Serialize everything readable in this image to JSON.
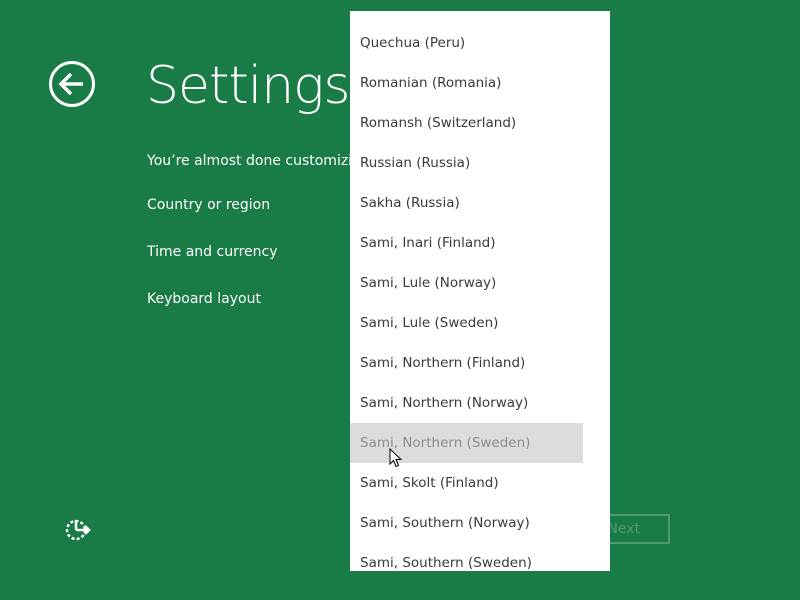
{
  "header": {
    "title": "Settings",
    "back_icon": "back-arrow-icon"
  },
  "main": {
    "intro": "You’re almost done customizing",
    "settings": [
      {
        "label": "Country or region"
      },
      {
        "label": "Time and currency"
      },
      {
        "label": "Keyboard layout"
      }
    ]
  },
  "footer": {
    "next_label": "Next",
    "ease_icon": "ease-of-access-icon"
  },
  "dropdown": {
    "items": [
      {
        "label": "Quechua (Peru)"
      },
      {
        "label": "Romanian (Romania)"
      },
      {
        "label": "Romansh (Switzerland)"
      },
      {
        "label": "Russian (Russia)"
      },
      {
        "label": "Sakha (Russia)"
      },
      {
        "label": "Sami, Inari (Finland)"
      },
      {
        "label": "Sami, Lule (Norway)"
      },
      {
        "label": "Sami, Lule (Sweden)"
      },
      {
        "label": "Sami, Northern (Finland)"
      },
      {
        "label": "Sami, Northern (Norway)"
      },
      {
        "label": "Sami, Northern (Sweden)",
        "hovered": true
      },
      {
        "label": "Sami, Skolt (Finland)"
      },
      {
        "label": "Sami, Southern (Norway)"
      },
      {
        "label": "Sami, Southern (Sweden)"
      }
    ]
  },
  "colors": {
    "background": "#197b45",
    "dropdown_background": "#ffffff",
    "hover_background": "#dcdcdc",
    "text_light": "#ffffff",
    "text_dark": "#3a3a3a",
    "disabled_button": "#4f9a6f"
  }
}
